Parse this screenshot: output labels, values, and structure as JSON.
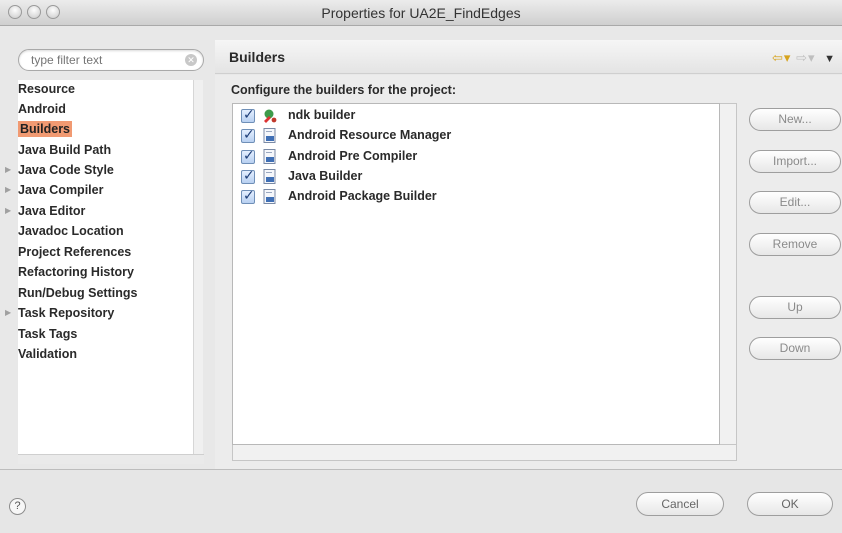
{
  "window": {
    "title": "Properties for UA2E_FindEdges"
  },
  "filter": {
    "placeholder": "type filter text",
    "clear_icon": "clear-icon"
  },
  "tree": {
    "items": [
      {
        "label": "Resource",
        "expandable": false,
        "selected": false
      },
      {
        "label": "Android",
        "expandable": false,
        "selected": false
      },
      {
        "label": "Builders",
        "expandable": false,
        "selected": true
      },
      {
        "label": "Java Build Path",
        "expandable": false,
        "selected": false
      },
      {
        "label": "Java Code Style",
        "expandable": true,
        "selected": false
      },
      {
        "label": "Java Compiler",
        "expandable": true,
        "selected": false
      },
      {
        "label": "Java Editor",
        "expandable": true,
        "selected": false
      },
      {
        "label": "Javadoc Location",
        "expandable": false,
        "selected": false
      },
      {
        "label": "Project References",
        "expandable": false,
        "selected": false
      },
      {
        "label": "Refactoring History",
        "expandable": false,
        "selected": false
      },
      {
        "label": "Run/Debug Settings",
        "expandable": false,
        "selected": false
      },
      {
        "label": "Task Repository",
        "expandable": true,
        "selected": false
      },
      {
        "label": "Task Tags",
        "expandable": false,
        "selected": false
      },
      {
        "label": "Validation",
        "expandable": false,
        "selected": false
      }
    ]
  },
  "panel": {
    "title": "Builders",
    "description": "Configure the builders for the project:",
    "builders": [
      {
        "label": "ndk builder",
        "checked": true,
        "icon": "external-tool-builder-icon"
      },
      {
        "label": "Android Resource Manager",
        "checked": true,
        "icon": "builder-icon"
      },
      {
        "label": "Android Pre Compiler",
        "checked": true,
        "icon": "builder-icon"
      },
      {
        "label": "Java Builder",
        "checked": true,
        "icon": "builder-icon"
      },
      {
        "label": "Android Package Builder",
        "checked": true,
        "icon": "builder-icon"
      }
    ],
    "buttons": {
      "new": "New...",
      "import": "Import...",
      "edit": "Edit...",
      "remove": "Remove",
      "up": "Up",
      "down": "Down"
    }
  },
  "footer": {
    "help_symbol": "?",
    "cancel": "Cancel",
    "ok": "OK"
  },
  "colors": {
    "selection": "#f19a72",
    "nav_arrow": "#d6a31d"
  }
}
